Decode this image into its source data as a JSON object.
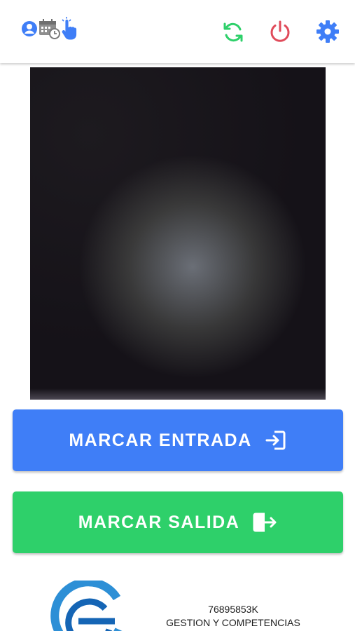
{
  "topbar": {
    "icons": {
      "user": "user-circle-icon",
      "calendar": "calendar-clock-icon",
      "hand": "hand-pointer-icon",
      "sync": "sync-icon",
      "power": "power-icon",
      "settings": "gear-icon"
    },
    "colors": {
      "blue": "#3f7ef7",
      "green": "#2ed06a",
      "red": "#e04b5a"
    }
  },
  "camera": {
    "label": "camera-preview"
  },
  "actions": {
    "entrada_label": "MARCAR ENTRADA",
    "salida_label": "MARCAR SALIDA"
  },
  "footer": {
    "id": "76895853K",
    "company": "GESTION Y COMPETENCIAS"
  }
}
